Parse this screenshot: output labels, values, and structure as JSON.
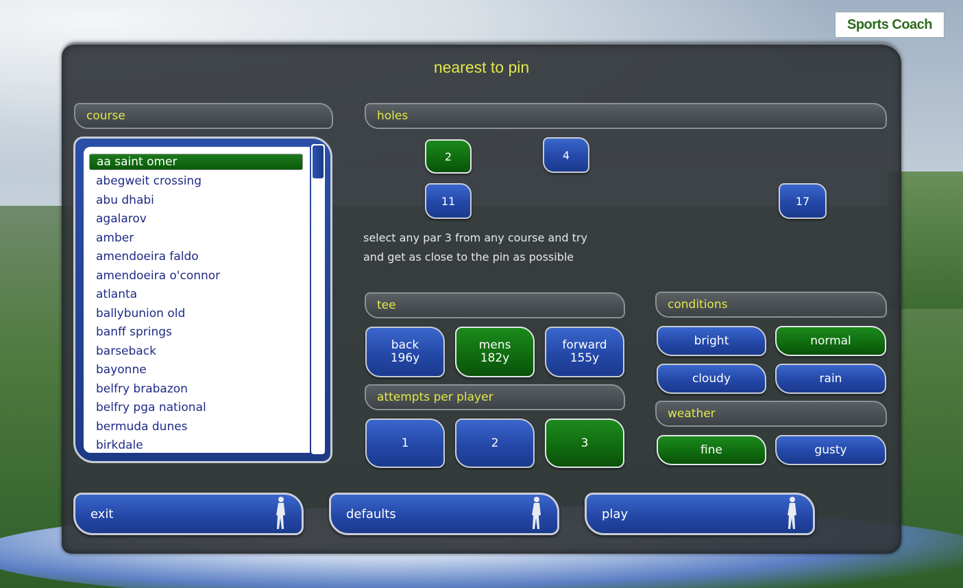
{
  "logo": {
    "text": "Sports Coach"
  },
  "title": "nearest to pin",
  "course": {
    "header": "course",
    "selected": "aa saint omer",
    "items": [
      "abegweit crossing",
      "abu dhabi",
      "agalarov",
      "amber",
      "amendoeira faldo",
      "amendoeira o'connor",
      "atlanta",
      "ballybunion old",
      "banff springs",
      "barseback",
      "bayonne",
      "belfry brabazon",
      "belfry pga national",
      "bermuda dunes",
      "birkdale"
    ]
  },
  "holes": {
    "header": "holes",
    "buttons": [
      "2",
      "4",
      "11",
      "17"
    ],
    "selected": "2",
    "description_line1": "select any par 3 from any course and try",
    "description_line2": "and get as close to the pin as possible"
  },
  "tee": {
    "header": "tee",
    "options": [
      {
        "name": "back",
        "yards": "196y"
      },
      {
        "name": "mens",
        "yards": "182y"
      },
      {
        "name": "forward",
        "yards": "155y"
      }
    ],
    "selected": "mens"
  },
  "attempts": {
    "header": "attempts per player",
    "options": [
      "1",
      "2",
      "3"
    ],
    "selected": "3"
  },
  "conditions": {
    "header": "conditions",
    "options": [
      "bright",
      "normal",
      "cloudy",
      "rain"
    ],
    "selected": "normal"
  },
  "weather": {
    "header": "weather",
    "options": [
      "fine",
      "gusty"
    ],
    "selected": "fine"
  },
  "actions": {
    "exit": "exit",
    "defaults": "defaults",
    "play": "play"
  },
  "colors": {
    "accent_yellow": "#e2e84a",
    "button_blue": "#2448a8",
    "button_green": "#0f6a0f",
    "panel": "#34383c"
  }
}
